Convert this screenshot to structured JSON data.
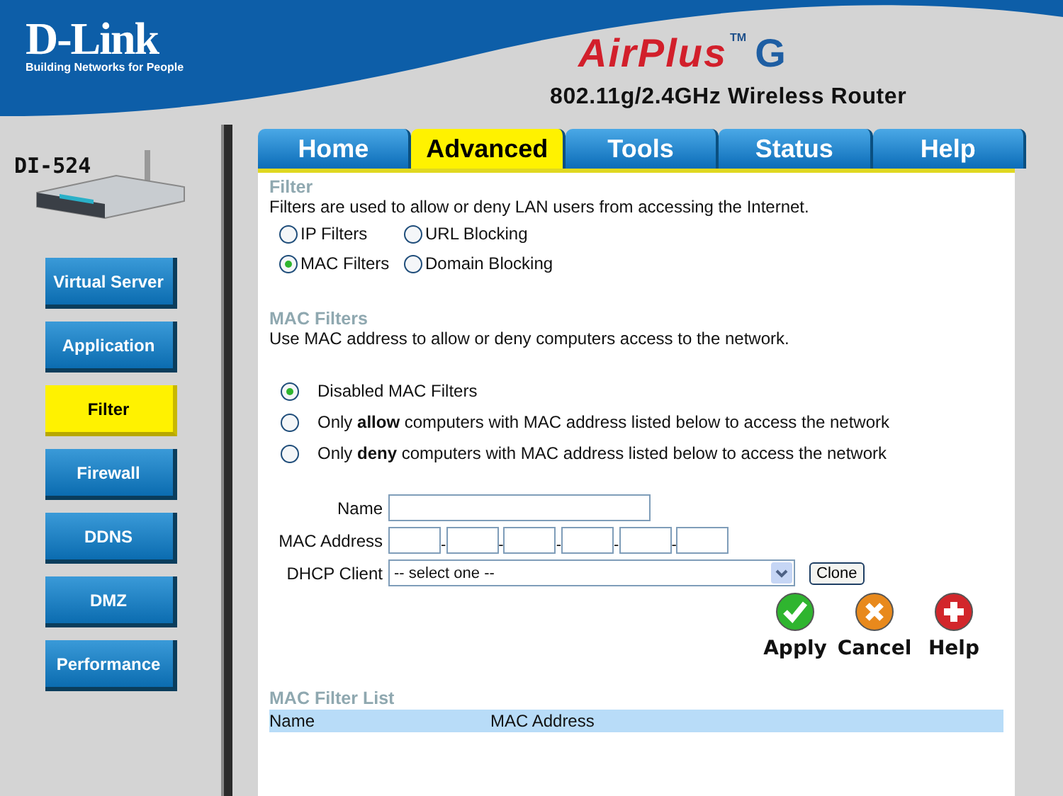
{
  "brand": {
    "logo": "D-Link",
    "tagline": "Building Networks for People",
    "product": "AirPlus",
    "trademark": "TM",
    "product_suffix": "G",
    "subtitle": "802.11g/2.4GHz Wireless Router",
    "model": "DI-524"
  },
  "tabs": [
    {
      "label": "Home",
      "selected": false
    },
    {
      "label": "Advanced",
      "selected": true
    },
    {
      "label": "Tools",
      "selected": false
    },
    {
      "label": "Status",
      "selected": false
    },
    {
      "label": "Help",
      "selected": false
    }
  ],
  "side_menu": [
    {
      "label": "Virtual Server",
      "selected": false
    },
    {
      "label": "Application",
      "selected": false
    },
    {
      "label": "Filter",
      "selected": true
    },
    {
      "label": "Firewall",
      "selected": false
    },
    {
      "label": "DDNS",
      "selected": false
    },
    {
      "label": "DMZ",
      "selected": false
    },
    {
      "label": "Performance",
      "selected": false
    }
  ],
  "filter": {
    "title": "Filter",
    "description": "Filters are used to allow or deny LAN users from accessing the Internet.",
    "options": [
      {
        "label": "IP Filters",
        "selected": false
      },
      {
        "label": "URL Blocking",
        "selected": false
      },
      {
        "label": "MAC Filters",
        "selected": true
      },
      {
        "label": "Domain Blocking",
        "selected": false
      }
    ]
  },
  "mac_filters": {
    "title": "MAC Filters",
    "description": "Use MAC address to allow or deny computers access to the network.",
    "modes": [
      {
        "label": "Disabled MAC Filters",
        "selected": true
      },
      {
        "label": "Only **allow** computers with MAC address listed below to access the network",
        "selected": false
      },
      {
        "label": "Only **deny** computers with MAC address listed below to access the network",
        "selected": false
      }
    ]
  },
  "form": {
    "name_label": "Name",
    "mac_label": "MAC Address",
    "mac_separators": [
      "-",
      "-",
      "-",
      "-",
      "-"
    ],
    "dhcp_label": "DHCP Client",
    "dhcp_value": "-- select one --",
    "clone": "Clone"
  },
  "actions": [
    {
      "kind": "apply",
      "label": "Apply"
    },
    {
      "kind": "cancel",
      "label": "Cancel"
    },
    {
      "kind": "help",
      "label": "Help"
    }
  ],
  "list": {
    "title": "MAC Filter List",
    "columns": [
      "Name",
      "MAC Address"
    ]
  }
}
